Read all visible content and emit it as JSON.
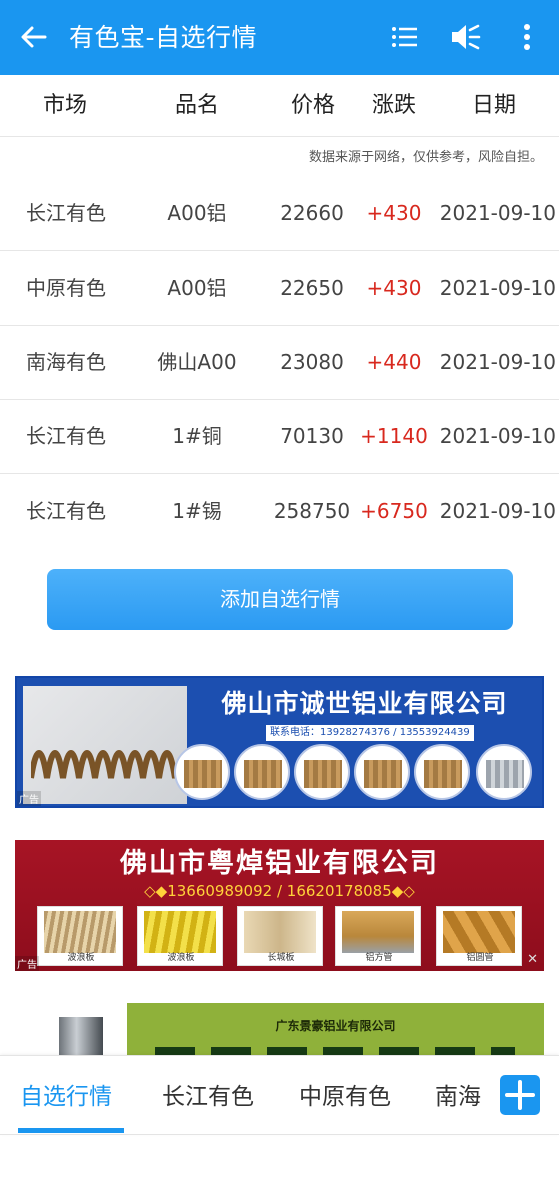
{
  "appbar": {
    "title": "有色宝-自选行情",
    "bg_color": "#1a96f0"
  },
  "table": {
    "headers": [
      "市场",
      "品名",
      "价格",
      "涨跌",
      "日期"
    ],
    "disclaimer": "数据来源于网络，仅供参考，风险自担。",
    "rows": [
      {
        "market": "长江有色",
        "name": "A00铝",
        "price": "22660",
        "change": "+430",
        "date": "2021-09-10"
      },
      {
        "market": "中原有色",
        "name": "A00铝",
        "price": "22650",
        "change": "+430",
        "date": "2021-09-10"
      },
      {
        "market": "南海有色",
        "name": "佛山A00",
        "price": "23080",
        "change": "+440",
        "date": "2021-09-10"
      },
      {
        "market": "长江有色",
        "name": "1#铜",
        "price": "70130",
        "change": "+1140",
        "date": "2021-09-10"
      },
      {
        "market": "长江有色",
        "name": "1#锡",
        "price": "258750",
        "change": "+6750",
        "date": "2021-09-10"
      }
    ],
    "up_color": "#d8281e"
  },
  "add_button": {
    "label": "添加自选行情"
  },
  "ads": [
    {
      "company": "佛山市诚世铝业有限公司",
      "phone": "联系电话：13928274376 / 13553924439",
      "label": "广告"
    },
    {
      "company": "佛山市粤焯铝业有限公司",
      "phones": "◇◆13660989092 / 16620178085◆◇",
      "label": "广告",
      "products": [
        "波浪板",
        "波浪板",
        "长城板",
        "铝方管",
        "铝圆管"
      ]
    },
    {
      "company": "广东景豪铝业有限公司"
    }
  ],
  "tabs": {
    "items": [
      "自选行情",
      "长江有色",
      "中原有色",
      "南海"
    ],
    "active": 0
  },
  "icons": [
    "back-arrow-icon",
    "list-icon",
    "speaker-mute-icon",
    "more-vertical-icon",
    "plus-icon"
  ]
}
